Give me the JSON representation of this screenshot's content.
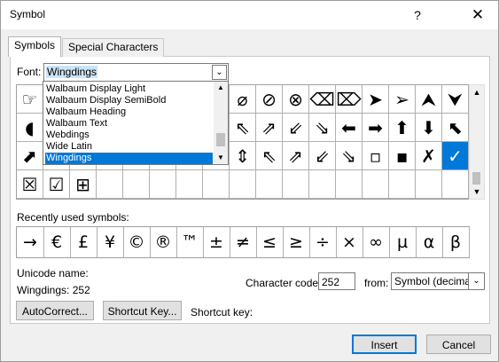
{
  "window": {
    "title": "Symbol",
    "help": "?",
    "close": "✕"
  },
  "tabs": [
    {
      "label": "Symbols"
    },
    {
      "label": "Special Characters"
    }
  ],
  "font": {
    "label": "Font:",
    "value": "Wingdings"
  },
  "dropdown": {
    "items": [
      "Walbaum Display Light",
      "Walbaum Display SemiBold",
      "Walbaum Heading",
      "Walbaum Text",
      "Webdings",
      "Wide Latin",
      "Wingdings"
    ],
    "selected_index": 6
  },
  "symbol_grid": {
    "rows": [
      [
        "☞",
        "",
        "",
        "",
        "",
        "",
        "",
        "",
        "⌀",
        "⊘",
        "⊗",
        "⌫",
        "⌦",
        "➤",
        "➢",
        "⮝",
        "⮟"
      ],
      [
        "◖",
        "",
        "",
        "",
        "",
        "",
        "",
        "",
        "⇖",
        "⇗",
        "⇙",
        "⇘",
        "⬅",
        "➡",
        "⬆",
        "⬇",
        "⬉"
      ],
      [
        "⬈",
        "",
        "",
        "",
        "",
        "",
        "",
        "",
        "⇕",
        "⇖",
        "⇗",
        "⇙",
        "⇘",
        "▫",
        "▪",
        "✗",
        "✓"
      ],
      [
        "☒",
        "☑",
        "⊞",
        "",
        "",
        "",
        "",
        "",
        "",
        "",
        "",
        "",
        "",
        "",
        "",
        "",
        ""
      ]
    ],
    "selected_row": 2,
    "selected_col": 16
  },
  "recent": {
    "label": "Recently used symbols:",
    "symbols": [
      "→",
      "€",
      "£",
      "¥",
      "©",
      "®",
      "™",
      "±",
      "≠",
      "≤",
      "≥",
      "÷",
      "×",
      "∞",
      "µ",
      "α",
      "β"
    ]
  },
  "unicode": {
    "label": "Unicode name:",
    "value": "Wingdings: 252"
  },
  "character_code": {
    "label": "Character code:",
    "value": "252"
  },
  "from": {
    "label": "from:",
    "value": "Symbol (decimal)"
  },
  "buttons": {
    "autocorrect": "AutoCorrect...",
    "shortcut_key": "Shortcut Key...",
    "insert": "Insert",
    "cancel": "Cancel"
  },
  "shortcut_key_label": "Shortcut key:"
}
